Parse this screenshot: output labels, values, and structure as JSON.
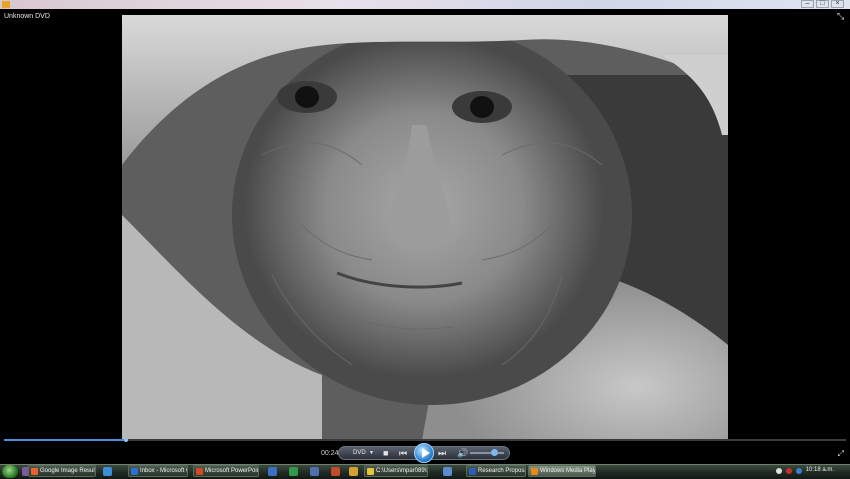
{
  "window": {
    "title": "Unknown DVD"
  },
  "player": {
    "elapsed": "00:24",
    "source_label": "DVD",
    "progress_fraction": 0.145,
    "volume_fraction": 0.7
  },
  "taskbar": {
    "buttons": [
      {
        "label": "Google Image Result...",
        "icon_color": "#e8642c"
      },
      {
        "label": "Inbox - Microsoft Ou...",
        "icon_color": "#2a6fd1"
      },
      {
        "label": "Microsoft PowerPoin...",
        "icon_color": "#d24726"
      },
      {
        "label": "C:\\Users\\mpar089\\D...",
        "icon_color": "#e8c23a"
      },
      {
        "label": "Research Proposal v0...",
        "icon_color": "#2b5fb8"
      },
      {
        "label": "Windows Media Player",
        "icon_color": "#e88a1a"
      }
    ],
    "clock": "10:18 a.m."
  }
}
